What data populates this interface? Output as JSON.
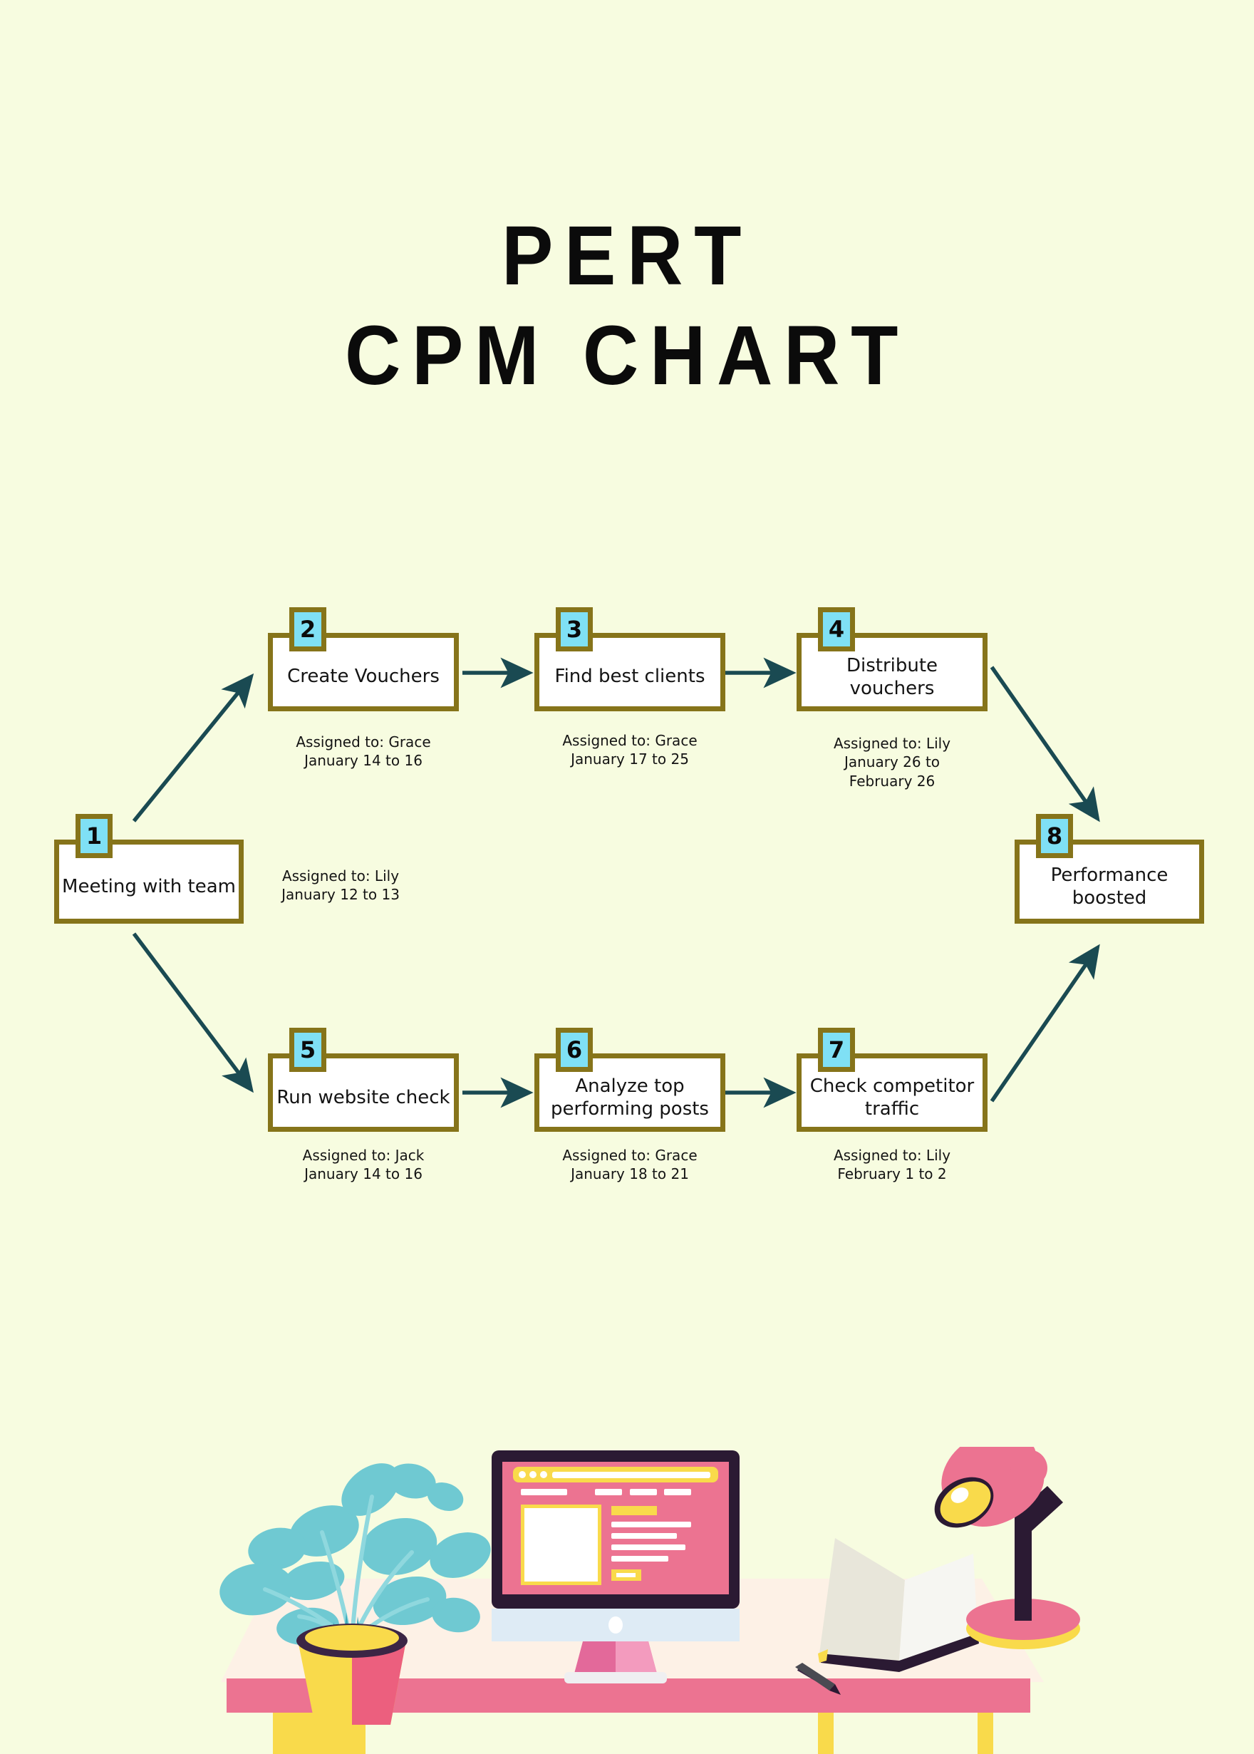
{
  "page": {
    "background_color": "#F7FCE0",
    "title_line1": "PERT",
    "title_line2": "CPM CHART"
  },
  "theme": {
    "node_border": "#86741A",
    "node_fill": "#FFFFFF",
    "badge_fill": "#7FE0F5",
    "arrow_color": "#1A4A52",
    "text_color": "#141414",
    "illustration_pink": "#EC7391",
    "illustration_yellow": "#F9DA4B",
    "illustration_dark": "#2B1A33",
    "illustration_teal": "#72CDD4",
    "desk_top": "#FDF1E6",
    "desk_edge": "#EC7391"
  },
  "chart_data": {
    "type": "diagram",
    "diagram_kind": "PERT / CPM network chart",
    "title": "PERT CPM CHART",
    "nodes": [
      {
        "id": 1,
        "number": "1",
        "label": "Meeting with team",
        "assigned_to": "Lily",
        "dates": "January 12 to 13",
        "caption": "Assigned to: Lily\nJanuary 12 to 13",
        "caption_position": "right"
      },
      {
        "id": 2,
        "number": "2",
        "label": "Create Vouchers",
        "assigned_to": "Grace",
        "dates": "January 14 to 16",
        "caption": "Assigned to: Grace\nJanuary 14 to 16",
        "caption_position": "below"
      },
      {
        "id": 3,
        "number": "3",
        "label": "Find best clients",
        "assigned_to": "Grace",
        "dates": "January 17 to 25",
        "caption": "Assigned to: Grace\nJanuary 17 to 25",
        "caption_position": "below"
      },
      {
        "id": 4,
        "number": "4",
        "label": "Distribute vouchers",
        "assigned_to": "Lily",
        "dates": "January 26 to February 26",
        "caption": "Assigned to: Lily\nJanuary 26 to\nFebruary 26",
        "caption_position": "below"
      },
      {
        "id": 5,
        "number": "5",
        "label": "Run website check",
        "assigned_to": "Jack",
        "dates": "January 14 to 16",
        "caption": "Assigned to: Jack\nJanuary 14 to 16",
        "caption_position": "below"
      },
      {
        "id": 6,
        "number": "6",
        "label": "Analyze top performing posts",
        "assigned_to": "Grace",
        "dates": "January 18 to 21",
        "caption": "Assigned to: Grace\nJanuary 18 to 21",
        "caption_position": "below"
      },
      {
        "id": 7,
        "number": "7",
        "label": "Check competitor traffic",
        "assigned_to": "Lily",
        "dates": "February 1 to 2",
        "caption": "Assigned to: Lily\nFebruary 1 to 2",
        "caption_position": "below"
      },
      {
        "id": 8,
        "number": "8",
        "label": "Performance boosted",
        "assigned_to": "",
        "dates": "",
        "caption": "",
        "caption_position": "none"
      }
    ],
    "edges": [
      {
        "from": 1,
        "to": 2,
        "style": "diagonal-up"
      },
      {
        "from": 2,
        "to": 3,
        "style": "horizontal"
      },
      {
        "from": 3,
        "to": 4,
        "style": "horizontal"
      },
      {
        "from": 4,
        "to": 8,
        "style": "diagonal-down"
      },
      {
        "from": 1,
        "to": 5,
        "style": "diagonal-down"
      },
      {
        "from": 5,
        "to": 6,
        "style": "horizontal"
      },
      {
        "from": 6,
        "to": 7,
        "style": "horizontal"
      },
      {
        "from": 7,
        "to": 8,
        "style": "diagonal-up"
      }
    ],
    "legend": [],
    "annotations": []
  },
  "illustration": {
    "name": "desk-workspace-illustration",
    "items": [
      "potted-plant",
      "desktop-monitor",
      "open-book-with-pen",
      "desk-lamp",
      "desk-table"
    ]
  }
}
